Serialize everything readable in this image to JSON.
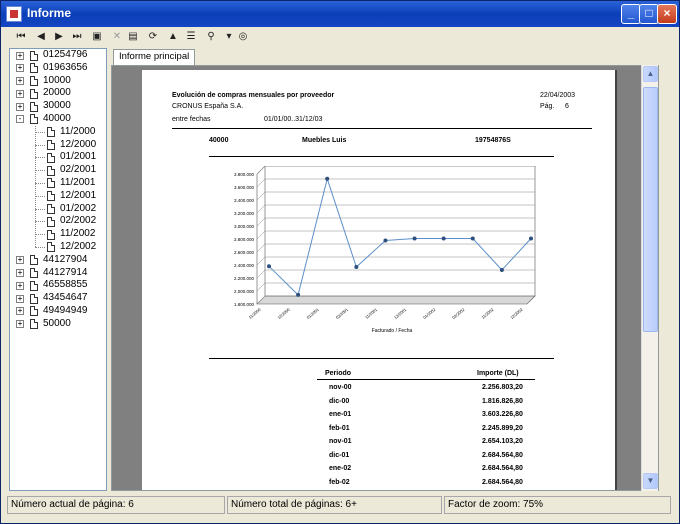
{
  "window": {
    "title": "Informe"
  },
  "toolbar": {
    "tools": [
      {
        "name": "first-page-icon",
        "glyph": "⏮"
      },
      {
        "name": "prev-page-icon",
        "glyph": "◀"
      },
      {
        "name": "next-page-icon",
        "glyph": "▶"
      },
      {
        "name": "last-page-icon",
        "glyph": "⏭"
      },
      {
        "name": "goto-page-icon",
        "glyph": "▣"
      },
      {
        "name": "stop-icon",
        "glyph": "✕"
      },
      {
        "name": "print-icon",
        "glyph": "▤"
      },
      {
        "name": "refresh-icon",
        "glyph": "⟳"
      },
      {
        "name": "export-icon",
        "glyph": "▲"
      },
      {
        "name": "tree-toggle-icon",
        "glyph": "☰"
      },
      {
        "name": "zoom-icon",
        "glyph": "⚲"
      },
      {
        "name": "zoom-dropdown-icon",
        "glyph": "▾"
      },
      {
        "name": "find-icon",
        "glyph": "◎"
      }
    ]
  },
  "tree": {
    "items": [
      {
        "label": "01254796",
        "level": 0,
        "expander": "+"
      },
      {
        "label": "01963656",
        "level": 0,
        "expander": "+"
      },
      {
        "label": "10000",
        "level": 0,
        "expander": "+"
      },
      {
        "label": "20000",
        "level": 0,
        "expander": "+"
      },
      {
        "label": "30000",
        "level": 0,
        "expander": "+"
      },
      {
        "label": "40000",
        "level": 0,
        "expander": "-"
      },
      {
        "label": "11/2000",
        "level": 1,
        "expander": ""
      },
      {
        "label": "12/2000",
        "level": 1,
        "expander": ""
      },
      {
        "label": "01/2001",
        "level": 1,
        "expander": ""
      },
      {
        "label": "02/2001",
        "level": 1,
        "expander": ""
      },
      {
        "label": "11/2001",
        "level": 1,
        "expander": ""
      },
      {
        "label": "12/2001",
        "level": 1,
        "expander": ""
      },
      {
        "label": "01/2002",
        "level": 1,
        "expander": ""
      },
      {
        "label": "02/2002",
        "level": 1,
        "expander": ""
      },
      {
        "label": "11/2002",
        "level": 1,
        "expander": ""
      },
      {
        "label": "12/2002",
        "level": 1,
        "expander": ""
      },
      {
        "label": "44127904",
        "level": 0,
        "expander": "+"
      },
      {
        "label": "44127914",
        "level": 0,
        "expander": "+"
      },
      {
        "label": "46558855",
        "level": 0,
        "expander": "+"
      },
      {
        "label": "43454647",
        "level": 0,
        "expander": "+"
      },
      {
        "label": "49494949",
        "level": 0,
        "expander": "+"
      },
      {
        "label": "50000",
        "level": 0,
        "expander": "+"
      }
    ]
  },
  "tabs": {
    "main": "Informe principal"
  },
  "report": {
    "title": "Evolución de compras mensuales por proveedor",
    "company": "CRONUS España S.A.",
    "date": "22/04/2003",
    "page_label": "Pág.",
    "page_number": "6",
    "range_label": "entre fechas",
    "range_value": "01/01/00..31/12/03",
    "vendor_no": "40000",
    "vendor_name": "Muebles Luis",
    "vendor_code": "19754876S",
    "table": {
      "col_period": "Periodo",
      "col_amount": "Importe (DL)",
      "rows": [
        {
          "period": "nov-00",
          "amount": "2.256.803,20"
        },
        {
          "period": "dic-00",
          "amount": "1.816.826,80"
        },
        {
          "period": "ene-01",
          "amount": "3.603.226,80"
        },
        {
          "period": "feb-01",
          "amount": "2.245.899,20"
        },
        {
          "period": "nov-01",
          "amount": "2.654.103,20"
        },
        {
          "period": "dic-01",
          "amount": "2.684.564,80"
        },
        {
          "period": "ene-02",
          "amount": "2.684.564,80"
        },
        {
          "period": "feb-02",
          "amount": "2.684.564,80"
        }
      ]
    }
  },
  "chart_data": {
    "type": "line",
    "xlabel": "Facturado / Fecha",
    "ylabel": "",
    "ylim": [
      1800000,
      3800000
    ],
    "yticks": [
      "3.800.000",
      "3.600.000",
      "3.400.000",
      "3.200.000",
      "3.000.000",
      "2.800.000",
      "2.600.000",
      "2.400.000",
      "2.200.000",
      "2.000.000",
      "1.800.000"
    ],
    "categories": [
      "11/2000",
      "12/2000",
      "01/2001",
      "02/2001",
      "11/2001",
      "12/2001",
      "01/2002",
      "02/2002",
      "11/2002",
      "12/2002"
    ],
    "values": [
      2256803.2,
      1816826.8,
      3603226.8,
      2245899.2,
      2654103.2,
      2684564.8,
      2684564.8,
      2684564.8,
      2200000,
      2684564.8
    ],
    "grid": true,
    "line_color": "#5b8fc8"
  },
  "status": {
    "current_page": "Número actual de página: 6",
    "total_pages": "Número total de páginas: 6+",
    "zoom": "Factor de zoom: 75%"
  }
}
